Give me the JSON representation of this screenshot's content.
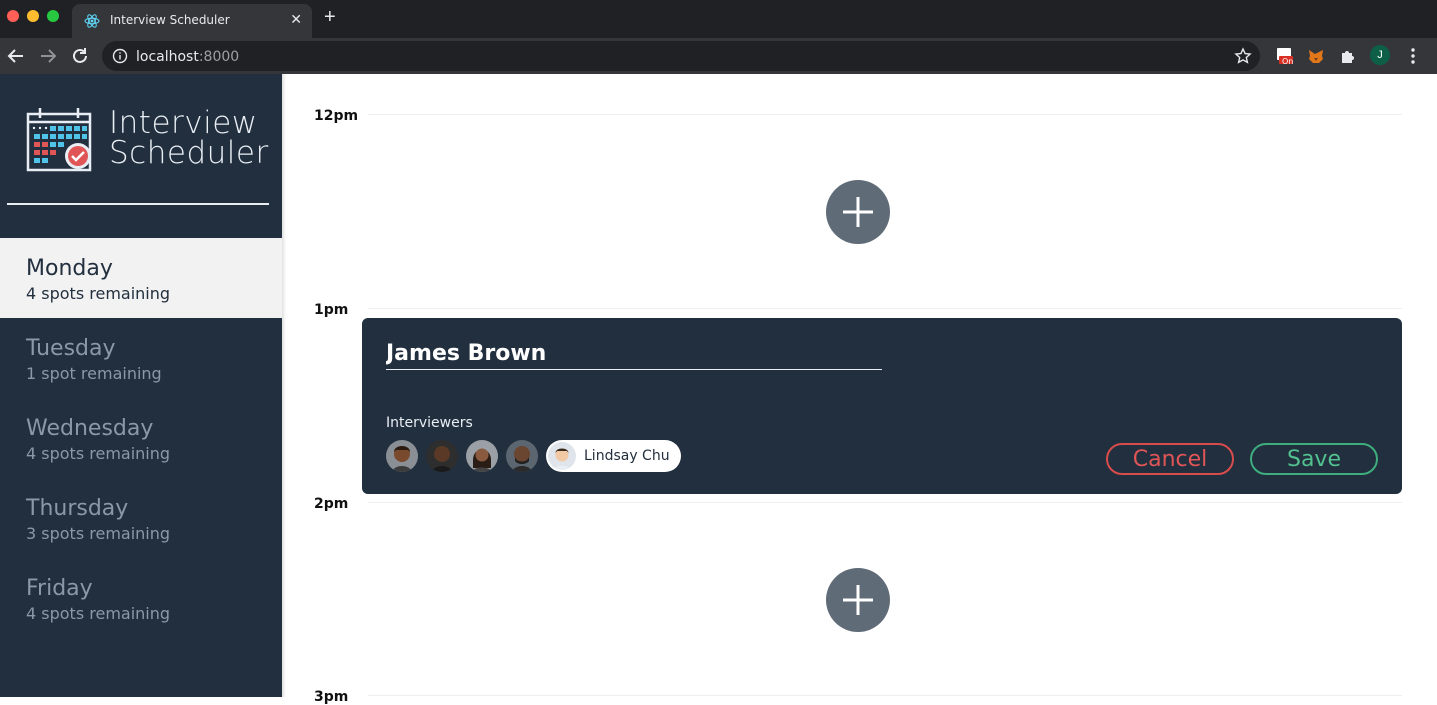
{
  "browser": {
    "tab_title": "Interview Scheduler",
    "url_host": "localhost",
    "url_port": ":8000",
    "profile_initial": "J",
    "extension_badge": "On"
  },
  "sidebar": {
    "brand_line1": "Interview",
    "brand_line2": "Scheduler",
    "days": [
      {
        "name": "Monday",
        "spots": "4 spots remaining",
        "selected": true
      },
      {
        "name": "Tuesday",
        "spots": "1 spot remaining",
        "selected": false
      },
      {
        "name": "Wednesday",
        "spots": "4 spots remaining",
        "selected": false
      },
      {
        "name": "Thursday",
        "spots": "3 spots remaining",
        "selected": false
      },
      {
        "name": "Friday",
        "spots": "4 spots remaining",
        "selected": false
      }
    ]
  },
  "schedule": {
    "slots": [
      "12pm",
      "1pm",
      "2pm",
      "3pm"
    ],
    "form": {
      "student_name": "James Brown",
      "interviewers_label": "Interviewers",
      "selected_interviewer": "Lindsay Chu",
      "cancel_label": "Cancel",
      "save_label": "Save"
    }
  },
  "colors": {
    "sidebar_bg": "#222f3e",
    "selected_day_bg": "#f2f2f2",
    "cancel": "#e05656",
    "save": "#52c08f",
    "add_button": "#606b78"
  }
}
